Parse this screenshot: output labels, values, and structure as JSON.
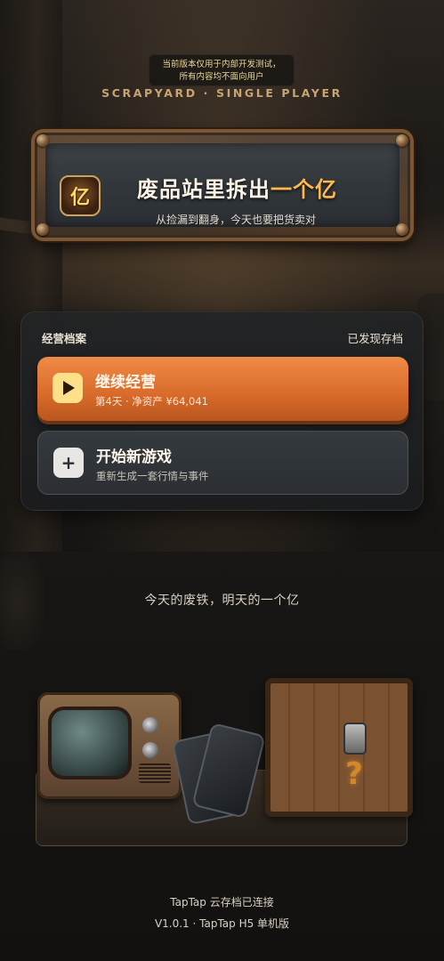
{
  "notice": {
    "line1": "当前版本仅用于内部开发测试，",
    "line2": "所有内容均不面向用户"
  },
  "mode_label": "SCRAPYARD · SINGLE PLAYER",
  "sign": {
    "icon_char": "亿",
    "title_main": "废品站里拆出",
    "title_highlight": "一个亿",
    "subtitle": "从捡漏到翻身，今天也要把货卖对"
  },
  "save_panel": {
    "title": "经营档案",
    "status": "已发现存档",
    "continue_button": {
      "label": "继续经营",
      "sub": "第4天 · 净资产 ¥64,041"
    },
    "new_game_button": {
      "label": "开始新游戏",
      "sub": "重新生成一套行情与事件"
    }
  },
  "tagline": "今天的废铁，明天的一个亿",
  "props": {
    "crate_mark": "?"
  },
  "footer": {
    "cloud_status": "TapTap 云存档已连接",
    "version": "V1.0.1 · TapTap H5 单机版"
  },
  "colors": {
    "accent": "#e07a36",
    "highlight": "#ffb84a",
    "panel_bg": "#222426"
  },
  "icons": {
    "continue": "play-icon",
    "new_game": "plus-icon"
  }
}
